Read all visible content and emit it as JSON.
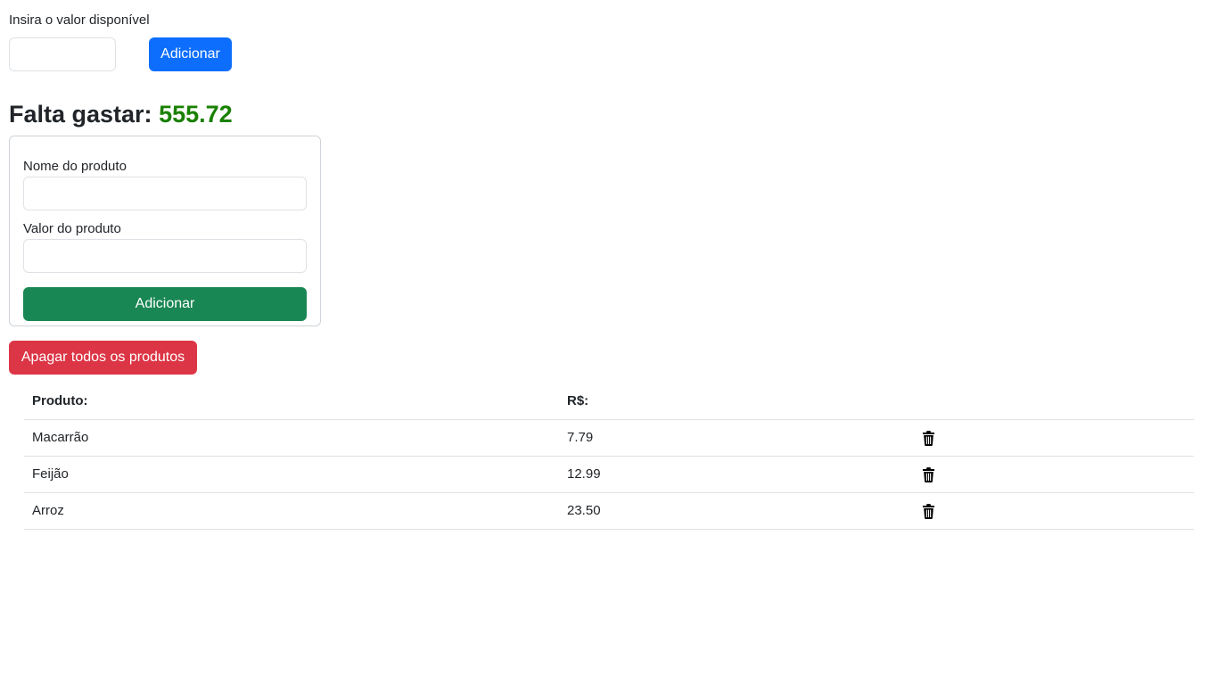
{
  "budget": {
    "label": "Insira o valor disponível",
    "input_value": "",
    "input_placeholder": "",
    "add_label": "Adicionar"
  },
  "summary": {
    "prefix": "Falta gastar:",
    "amount": "555.72",
    "amount_color": "#198000"
  },
  "product_form": {
    "name_label": "Nome do produto",
    "name_value": "",
    "value_label": "Valor do produto",
    "value_value": "",
    "add_label": "Adicionar"
  },
  "actions": {
    "delete_all_label": "Apagar todos os produtos"
  },
  "table": {
    "headers": {
      "product": "Produto:",
      "price": "R$:"
    },
    "rows": [
      {
        "name": "Macarrão",
        "price": "7.79",
        "action_icon": "trash-icon"
      },
      {
        "name": "Feijão",
        "price": "12.99",
        "action_icon": "trash-icon"
      },
      {
        "name": "Arroz",
        "price": "23.50",
        "action_icon": "trash-icon"
      }
    ]
  },
  "colors": {
    "primary": "#0d6efd",
    "success": "#198754",
    "danger": "#dc3545"
  }
}
